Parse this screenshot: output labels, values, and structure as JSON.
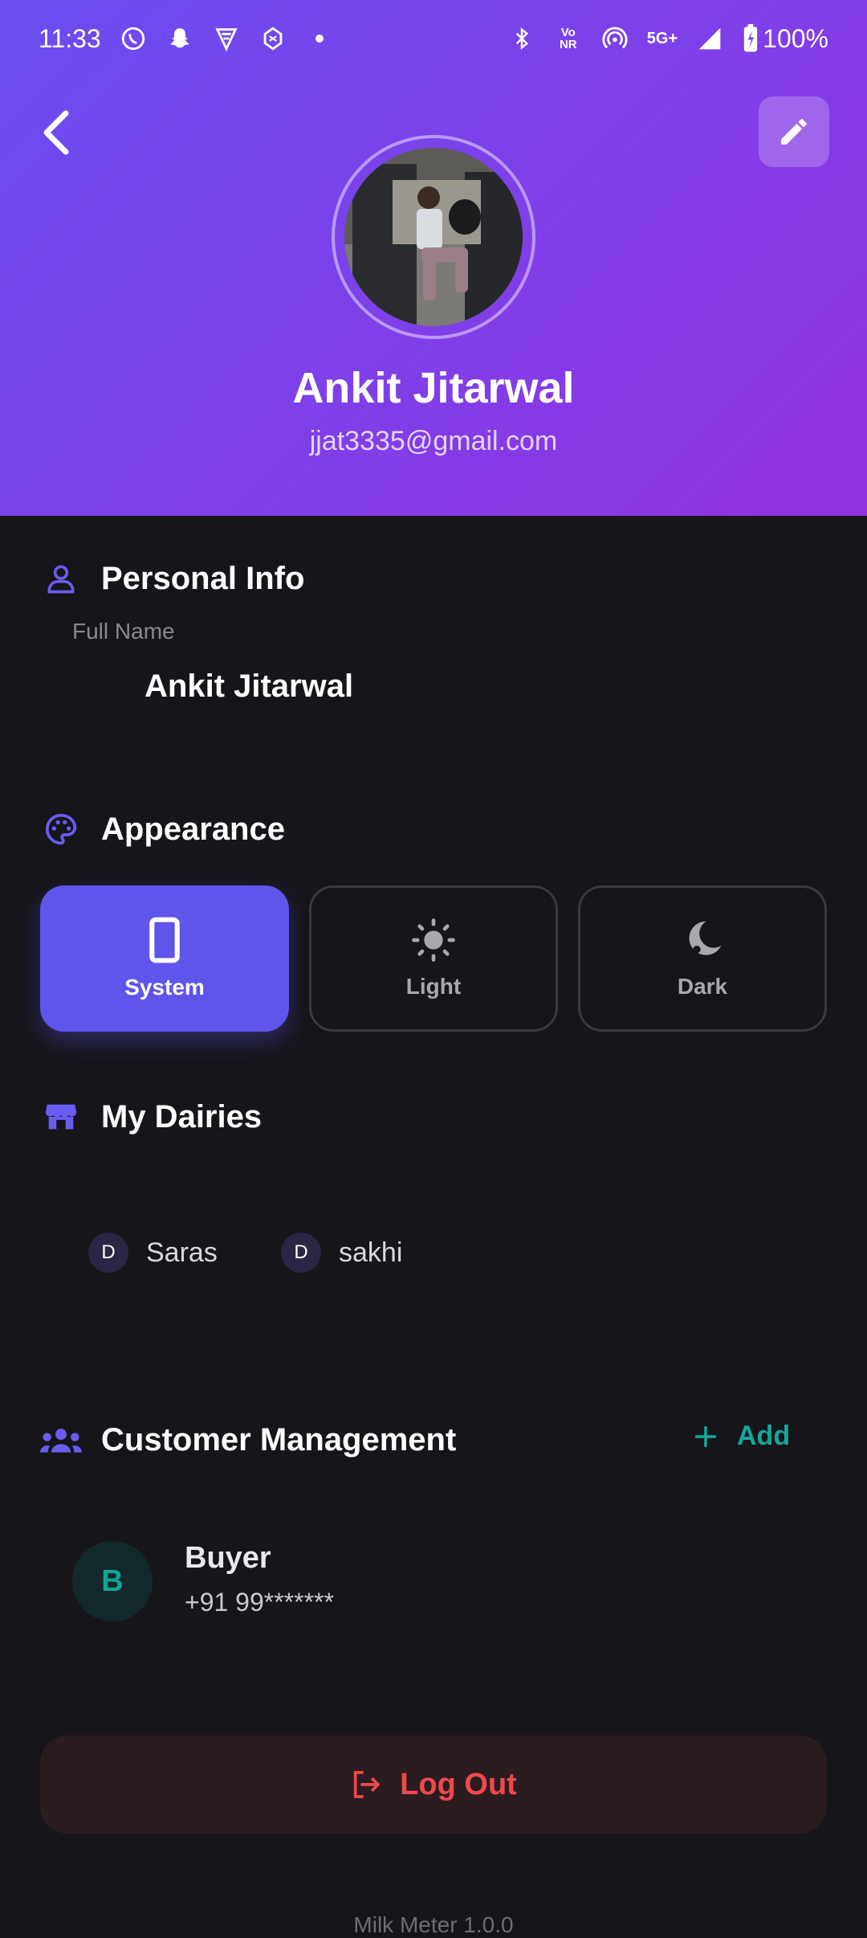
{
  "status_bar": {
    "time": "11:33",
    "network": "5G+",
    "battery": "100%",
    "left_icons": [
      "whatsapp-icon",
      "snapchat-icon",
      "vpn-icon",
      "app-icon",
      "dot-icon"
    ],
    "right_icons": [
      "bluetooth-icon",
      "vonr-icon",
      "hotspot-icon",
      "5g-icon",
      "signal-icon",
      "battery-icon"
    ]
  },
  "header": {
    "back_icon": "chevron-left-icon",
    "edit_icon": "pencil-icon",
    "name": "Ankit Jitarwal",
    "email": "jjat3335@gmail.com",
    "gradient_start": "#6a4df0",
    "gradient_end": "#9331e0"
  },
  "personal_info": {
    "title": "Personal Info",
    "icon": "person-icon",
    "field_label": "Full Name",
    "field_value": "Ankit Jitarwal"
  },
  "appearance": {
    "title": "Appearance",
    "icon": "palette-icon",
    "options": [
      {
        "label": "System",
        "icon": "phone-icon",
        "selected": true
      },
      {
        "label": "Light",
        "icon": "sun-icon",
        "selected": false
      },
      {
        "label": "Dark",
        "icon": "moon-icon",
        "selected": false
      }
    ],
    "accent": "#5f55ea"
  },
  "dairies": {
    "title": "My Dairies",
    "icon": "store-icon",
    "items": [
      {
        "initial": "D",
        "name": "Saras"
      },
      {
        "initial": "D",
        "name": "sakhi"
      }
    ]
  },
  "customers": {
    "title": "Customer Management",
    "icon": "group-icon",
    "add_label": "Add",
    "accent": "#16a89a",
    "items": [
      {
        "initial": "B",
        "name": "Buyer",
        "phone": "+91 99*******"
      }
    ]
  },
  "logout": {
    "label": "Log Out",
    "icon": "logout-icon",
    "color": "#f0494b"
  },
  "footer": {
    "version": "Milk Meter 1.0.0"
  }
}
